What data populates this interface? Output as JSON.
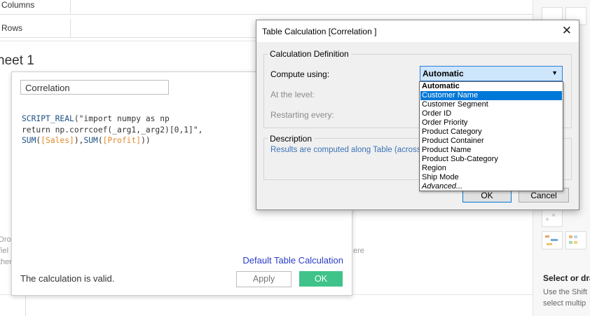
{
  "shelves": {
    "columns_label": "Columns",
    "rows_label": "Rows"
  },
  "sheet": {
    "title": "heet 1"
  },
  "calc_editor": {
    "name_value": "Correlation",
    "code_line1_fn": "SCRIPT_REAL",
    "code_line1_rest": "(\"import numpy as np",
    "code_line2": "return np.corrcoef(_arg1,_arg2)[0,1]\",",
    "code_line3_fn1": "SUM",
    "code_line3_f1": "[Sales]",
    "code_line3_fn2": "SUM",
    "code_line3_f2": "[Profit]",
    "default_link": "Default Table Calculation",
    "status": "The calculation is valid.",
    "apply_label": "Apply",
    "ok_label": "OK"
  },
  "background_text": {
    "left_fragment_1": "Dro",
    "left_fragment_2": "fiel",
    "left_fragment_3": "ther",
    "right_fragment": "ere"
  },
  "right_panel": {
    "heading": "Select or dra",
    "hint_line1": "Use the Shift",
    "hint_line2": "select multip"
  },
  "dialog": {
    "title": "Table Calculation [Correlation ]",
    "close_symbol": "✕",
    "group_definition": "Calculation Definition",
    "compute_using_label": "Compute using:",
    "compute_using_value": "Automatic",
    "at_level_label": "At the level:",
    "restarting_label": "Restarting every:",
    "group_description": "Description",
    "description_text": "Results are computed along Table (across).",
    "ok_label": "OK",
    "cancel_label": "Cancel"
  },
  "dropdown": {
    "options": [
      "Automatic",
      "Customer Name",
      "Customer Segment",
      "Order ID",
      "Order Priority",
      "Product Category",
      "Product Container",
      "Product Name",
      "Product Sub-Category",
      "Region",
      "Ship Mode",
      "Advanced..."
    ],
    "selected_index": 1
  },
  "colors": {
    "accent_green": "#3fc38a",
    "link_blue": "#2b3cc8",
    "selection_blue": "#0078d7",
    "field_orange": "#e28a2b",
    "function_blue": "#1e4f86"
  }
}
